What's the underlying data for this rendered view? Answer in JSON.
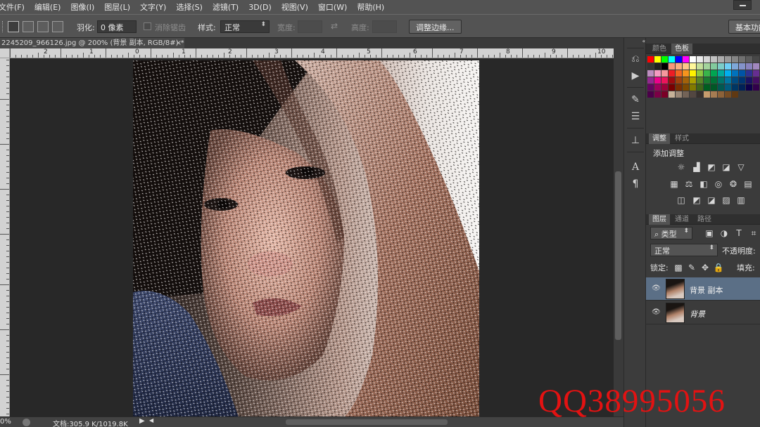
{
  "menubar": {
    "items": [
      "文件(F)",
      "编辑(E)",
      "图像(I)",
      "图层(L)",
      "文字(Y)",
      "选择(S)",
      "滤镜(T)",
      "3D(D)",
      "视图(V)",
      "窗口(W)",
      "帮助(H)"
    ]
  },
  "options": {
    "feather_label": "羽化:",
    "feather_value": "0 像素",
    "antialias_label": "消除锯齿",
    "style_label": "样式:",
    "style_value": "正常",
    "width_label": "宽度:",
    "height_label": "高度:",
    "refine_edge_button": "调整边缘...",
    "workspace_button": "基本功能"
  },
  "document": {
    "tab_title": "2245209_966126.jpg @ 200% (背景 副本, RGB/8#) *",
    "close_glyph": "×"
  },
  "ruler": {
    "labels": [
      "2",
      "1",
      "0",
      "1",
      "2",
      "3",
      "4",
      "5",
      "6",
      "7",
      "8",
      "9",
      "10"
    ]
  },
  "status": {
    "zoom": "0%",
    "doc_info": "文档:305.9 K/1019.8K"
  },
  "swatches_panel": {
    "tab_color": "颜色",
    "tab_swatches": "色板"
  },
  "adjustments_panel": {
    "tab_adjust": "调整",
    "tab_styles": "样式",
    "title": "添加调整"
  },
  "layers_panel": {
    "tab_layers": "图层",
    "tab_channels": "通道",
    "tab_paths": "路径",
    "filter_kind": "类型",
    "blend_mode": "正常",
    "opacity_label": "不透明度:",
    "lock_label": "锁定:",
    "fill_label": "填充:",
    "layers": [
      {
        "name": "背景 副本",
        "selected": true
      },
      {
        "name": "背景",
        "selected": false
      }
    ]
  },
  "watermark": {
    "text": "QQ38995056"
  }
}
